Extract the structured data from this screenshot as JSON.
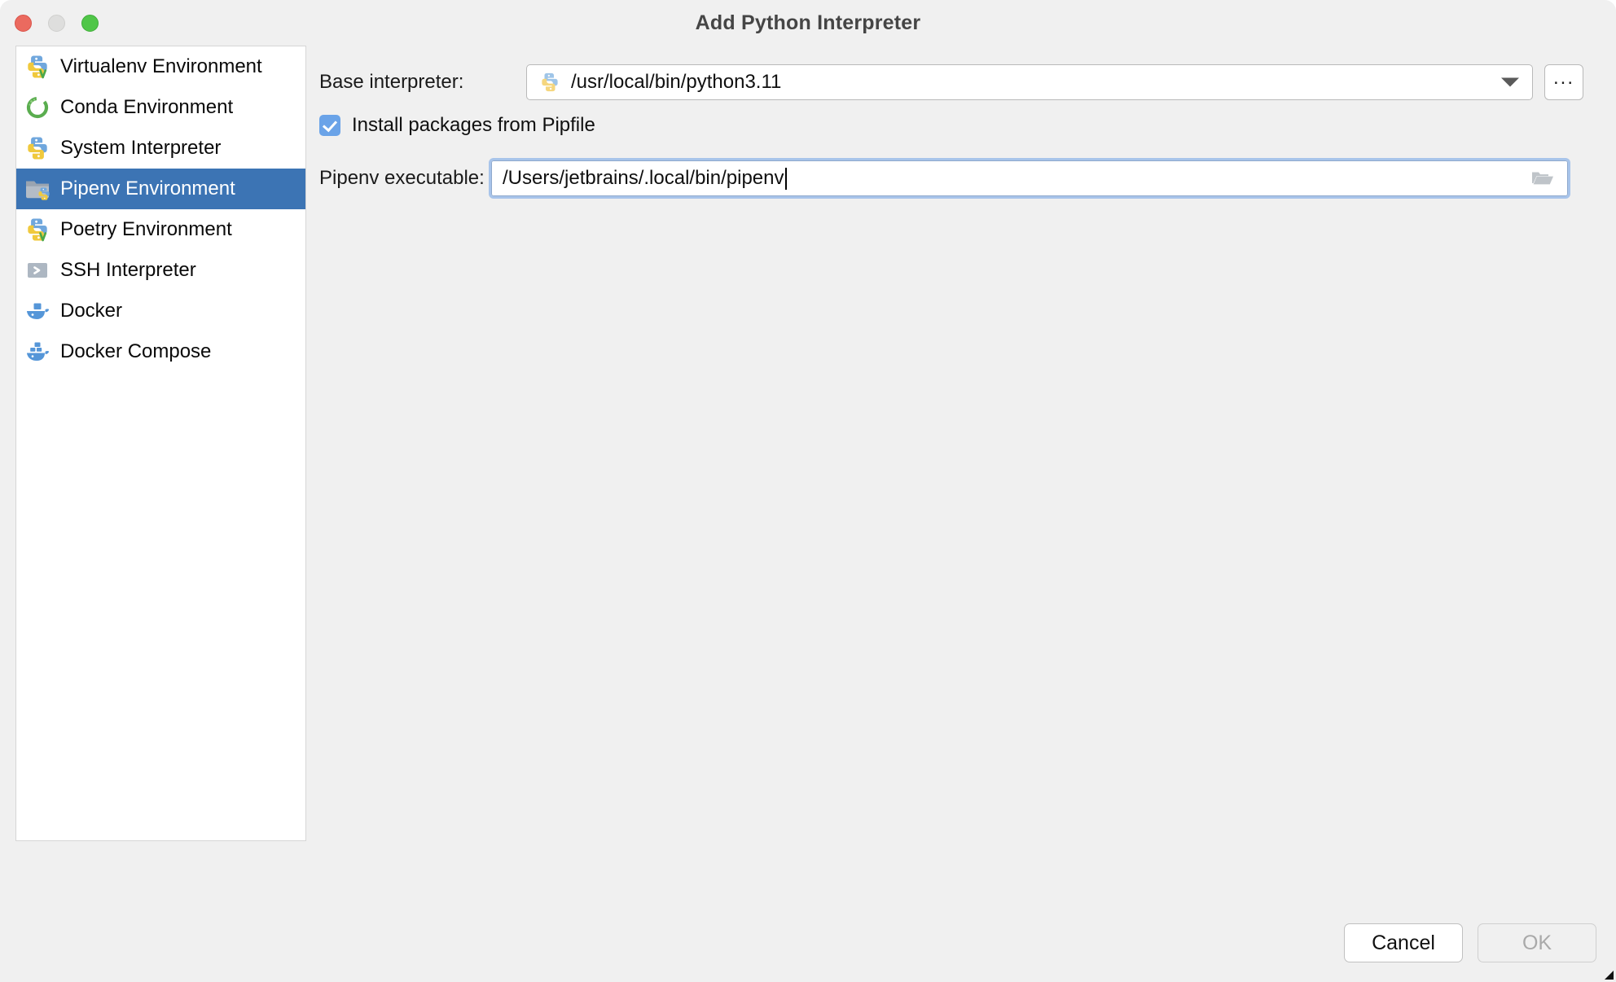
{
  "window": {
    "title": "Add Python Interpreter",
    "traffic_lights": [
      {
        "name": "close",
        "color": "#eb6a5f"
      },
      {
        "name": "minimize",
        "color": "#dededd"
      },
      {
        "name": "maximize",
        "color": "#50c648"
      }
    ],
    "background": "#f0f0f0"
  },
  "sidebar": {
    "selected_index": 3,
    "selection_color": "#3c74b4",
    "items": [
      {
        "label": "Virtualenv Environment",
        "icon": "python-venv-icon"
      },
      {
        "label": "Conda Environment",
        "icon": "conda-ring-icon"
      },
      {
        "label": "System Interpreter",
        "icon": "python-icon"
      },
      {
        "label": "Pipenv Environment",
        "icon": "pipenv-folder-python-icon"
      },
      {
        "label": "Poetry Environment",
        "icon": "python-venv-icon"
      },
      {
        "label": "SSH Interpreter",
        "icon": "ssh-chevron-icon"
      },
      {
        "label": "Docker",
        "icon": "docker-whale-icon"
      },
      {
        "label": "Docker Compose",
        "icon": "docker-compose-whale-icon"
      }
    ]
  },
  "form": {
    "base_interpreter": {
      "label": "Base interpreter:",
      "value": "/usr/local/bin/python3.11",
      "icon": "python-icon",
      "dropdown_icon": "chevron-down-icon",
      "browse_button_label": "...",
      "browse_button_icon": "ellipsis-icon"
    },
    "install_packages": {
      "label": "Install packages from Pipfile",
      "checked": true,
      "checkbox_color": "#6aa3e8"
    },
    "pipenv_executable": {
      "label": "Pipenv executable:",
      "value": "/Users/jetbrains/.local/bin/pipenv",
      "focused": true,
      "focus_color": "#a8c4ea",
      "browse_icon": "folder-open-icon"
    }
  },
  "footer": {
    "cancel_label": "Cancel",
    "ok_label": "OK",
    "ok_enabled": false
  }
}
